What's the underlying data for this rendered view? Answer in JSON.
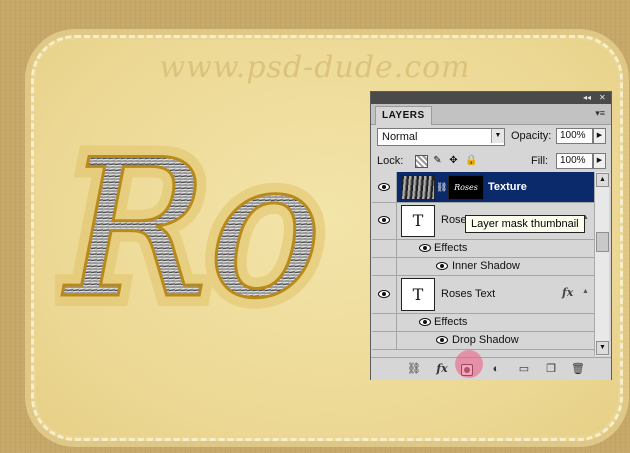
{
  "canvas": {
    "watermark_text": "www.psd-dude.com",
    "artwork_text": "Ro"
  },
  "layers_panel": {
    "tab_label": "LAYERS",
    "blend_mode": "Normal",
    "opacity_label": "Opacity:",
    "opacity_value": "100%",
    "lock_label": "Lock:",
    "fill_label": "Fill:",
    "fill_value": "100%",
    "layers": [
      {
        "name": "Texture",
        "selected": true,
        "mask_text": "Roses"
      },
      {
        "name": "Roses",
        "thumb": "T",
        "effects_label": "Effects",
        "effects": [
          "Inner Shadow"
        ]
      },
      {
        "name": "Roses Text",
        "thumb": "T",
        "fx": "fx",
        "effects_label": "Effects",
        "effects": [
          "Drop Shadow"
        ]
      }
    ],
    "tooltip": "Layer mask thumbnail"
  },
  "colors": {
    "selected_row": "#0a2a6b",
    "accent_pink": "#e8557a"
  }
}
